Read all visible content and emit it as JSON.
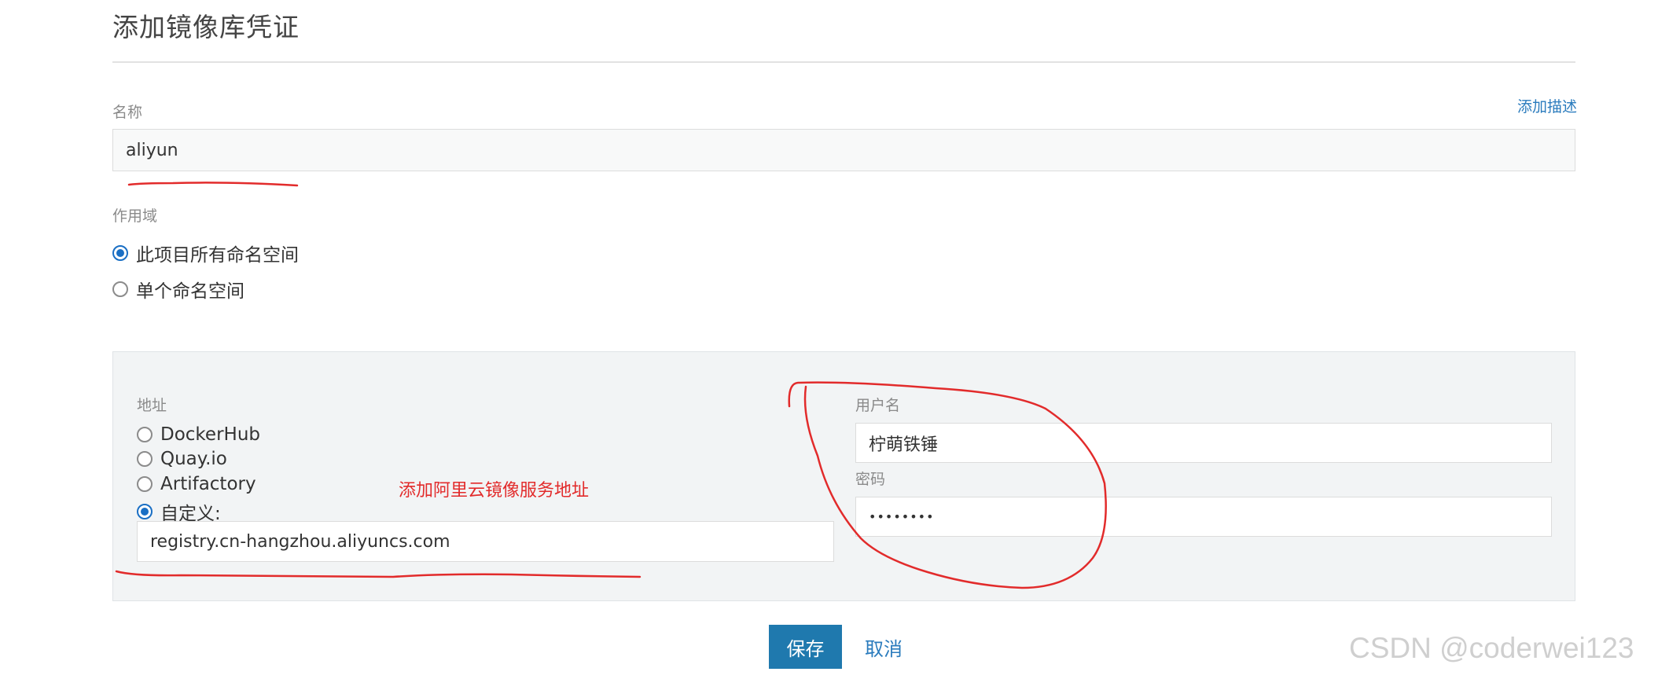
{
  "page": {
    "title": "添加镜像库凭证"
  },
  "name_field": {
    "label": "名称",
    "value": "aliyun",
    "add_description_link": "添加描述"
  },
  "scope": {
    "label": "作用域",
    "options": [
      {
        "label": "此项目所有命名空间",
        "checked": true
      },
      {
        "label": "单个命名空间",
        "checked": false
      }
    ]
  },
  "registry": {
    "address_label": "地址",
    "options": [
      {
        "label": "DockerHub",
        "checked": false
      },
      {
        "label": "Quay.io",
        "checked": false
      },
      {
        "label": "Artifactory",
        "checked": false
      },
      {
        "label": "自定义:",
        "checked": true
      }
    ],
    "custom_value": "registry.cn-hangzhou.aliyuncs.com",
    "username_label": "用户名",
    "username_value": "柠萌铁锤",
    "password_label": "密码",
    "password_value": "••••••••"
  },
  "annotation": {
    "text": "添加阿里云镜像服务地址",
    "color": "#e22b2b"
  },
  "actions": {
    "save_label": "保存",
    "cancel_label": "取消"
  },
  "watermark": "CSDN @coderwei123",
  "colors": {
    "accent": "#1f79ae",
    "link": "#2a7bbd",
    "radio_checked": "#1a6fc4",
    "panel_bg": "#f2f4f5"
  }
}
